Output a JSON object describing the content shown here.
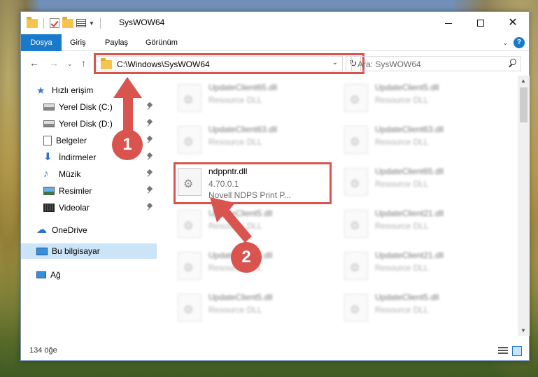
{
  "window": {
    "title": "SysWOW64",
    "controls": {
      "minimize": "",
      "maximize": "",
      "close": "✕"
    }
  },
  "ribbon": {
    "tabs": [
      "Dosya",
      "Giriş",
      "Paylaş",
      "Görünüm"
    ],
    "help": "?"
  },
  "address": {
    "path": "C:\\Windows\\SysWOW64",
    "search_placeholder": "Ara: SysWOW64"
  },
  "nav": {
    "items": [
      {
        "label": "Hızlı erişim",
        "icon": "star-icon",
        "pinned": false
      },
      {
        "label": "Yerel Disk (C:)",
        "icon": "disk-icon",
        "pinned": true
      },
      {
        "label": "Yerel Disk (D:)",
        "icon": "disk-icon",
        "pinned": true
      },
      {
        "label": "Belgeler",
        "icon": "document-icon",
        "pinned": true
      },
      {
        "label": "İndirmeler",
        "icon": "download-icon",
        "pinned": true
      },
      {
        "label": "Müzik",
        "icon": "music-icon",
        "pinned": true
      },
      {
        "label": "Resimler",
        "icon": "pictures-icon",
        "pinned": true
      },
      {
        "label": "Videolar",
        "icon": "video-icon",
        "pinned": true
      },
      {
        "label": "OneDrive",
        "icon": "cloud-icon",
        "pinned": false
      },
      {
        "label": "Bu bilgisayar",
        "icon": "computer-icon",
        "pinned": false,
        "selected": true
      },
      {
        "label": "Ağ",
        "icon": "network-icon",
        "pinned": false
      }
    ]
  },
  "files": {
    "left": [
      {
        "name": "UpdateClient65.dll",
        "desc": "Resource DLL"
      },
      {
        "name": "UpdateClient63.dll",
        "desc": "Resource DLL"
      },
      {
        "name": "ndppntr.dll",
        "version": "4.70.0.1",
        "desc": "Novell NDPS Print P..."
      },
      {
        "name": "UpdateClient5.dll",
        "desc": "Resource DLL"
      },
      {
        "name": "UpdateClient5.dll",
        "desc": "Resource DLL"
      },
      {
        "name": "UpdateClient5.dll",
        "desc": "Resource DLL"
      }
    ],
    "right": [
      {
        "name": "UpdateClient5.dll",
        "desc": "Resource DLL"
      },
      {
        "name": "UpdateClient63.dll",
        "desc": "Resource DLL"
      },
      {
        "name": "UpdateClient65.dll",
        "desc": "Resource DLL"
      },
      {
        "name": "UpdateClient21.dll",
        "desc": "Resource DLL"
      },
      {
        "name": "UpdateClient21.dll",
        "desc": "Resource DLL"
      },
      {
        "name": "UpdateClient5.dll",
        "desc": "Resource DLL"
      }
    ]
  },
  "status": {
    "count": "134 öğe"
  },
  "annotations": {
    "step1": "1",
    "step2": "2",
    "color": "#d9534f"
  }
}
